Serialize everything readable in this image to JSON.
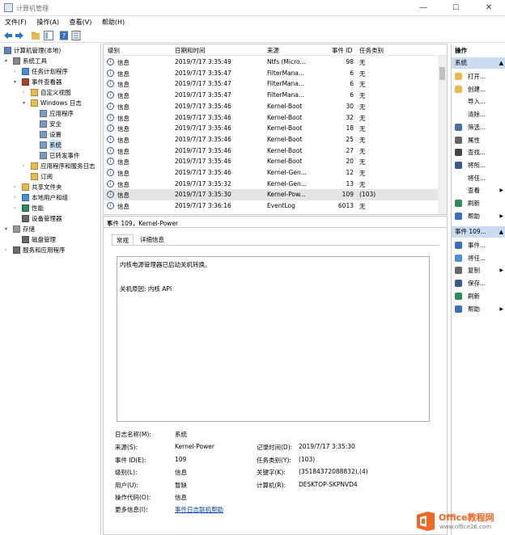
{
  "window": {
    "title": "计算机管理",
    "minimize": "—",
    "maximize": "☐",
    "close": "✕"
  },
  "menu": [
    "文件(F)",
    "操作(A)",
    "查看(V)",
    "帮助(H)"
  ],
  "tree": [
    {
      "label": "计算机管理(本地)",
      "level": 0,
      "exp": "",
      "icon": "computer-icon"
    },
    {
      "label": "系统工具",
      "level": 1,
      "exp": "▾",
      "icon": "tools-icon"
    },
    {
      "label": "任务计划程序",
      "level": 2,
      "exp": "›",
      "icon": "clock-icon"
    },
    {
      "label": "事件查看器",
      "level": 2,
      "exp": "▾",
      "icon": "event-viewer-icon"
    },
    {
      "label": "自定义视图",
      "level": 3,
      "exp": "›",
      "icon": "folder-icon"
    },
    {
      "label": "Windows 日志",
      "level": 3,
      "exp": "▾",
      "icon": "folder-icon"
    },
    {
      "label": "应用程序",
      "level": 4,
      "exp": "",
      "icon": "log-icon"
    },
    {
      "label": "安全",
      "level": 4,
      "exp": "",
      "icon": "log-icon"
    },
    {
      "label": "设置",
      "level": 4,
      "exp": "",
      "icon": "log-icon"
    },
    {
      "label": "系统",
      "level": 4,
      "exp": "",
      "icon": "log-icon",
      "selected": true
    },
    {
      "label": "已转发事件",
      "level": 4,
      "exp": "",
      "icon": "log-icon"
    },
    {
      "label": "应用程序和服务日志",
      "level": 3,
      "exp": "›",
      "icon": "folder-icon"
    },
    {
      "label": "订阅",
      "level": 3,
      "exp": "",
      "icon": "subscription-icon"
    },
    {
      "label": "共享文件夹",
      "level": 2,
      "exp": "›",
      "icon": "shared-folder-icon"
    },
    {
      "label": "本地用户和组",
      "level": 2,
      "exp": "›",
      "icon": "users-icon"
    },
    {
      "label": "性能",
      "level": 2,
      "exp": "›",
      "icon": "performance-icon"
    },
    {
      "label": "设备管理器",
      "level": 2,
      "exp": "",
      "icon": "device-manager-icon"
    },
    {
      "label": "存储",
      "level": 1,
      "exp": "▾",
      "icon": "storage-icon"
    },
    {
      "label": "磁盘管理",
      "level": 2,
      "exp": "",
      "icon": "disk-icon"
    },
    {
      "label": "服务和应用程序",
      "level": 1,
      "exp": "›",
      "icon": "services-icon"
    }
  ],
  "events": {
    "headers": [
      "级别",
      "日期和时间",
      "来源",
      "事件 ID",
      "任务类别"
    ],
    "rows": [
      [
        "信息",
        "2019/7/17 3:35:49",
        "Ntfs (Micro...",
        "98",
        "无"
      ],
      [
        "信息",
        "2019/7/17 3:35:47",
        "FilterMana...",
        "6",
        "无"
      ],
      [
        "信息",
        "2019/7/17 3:35:47",
        "FilterMana...",
        "6",
        "无"
      ],
      [
        "信息",
        "2019/7/17 3:35:47",
        "FilterMana...",
        "6",
        "无"
      ],
      [
        "信息",
        "2019/7/17 3:35:46",
        "Kernel-Boot",
        "30",
        "无"
      ],
      [
        "信息",
        "2019/7/17 3:35:46",
        "Kernel-Boot",
        "32",
        "无"
      ],
      [
        "信息",
        "2019/7/17 3:35:46",
        "Kernel-Boot",
        "18",
        "无"
      ],
      [
        "信息",
        "2019/7/17 3:35:46",
        "Kernel-Boot",
        "25",
        "无"
      ],
      [
        "信息",
        "2019/7/17 3:35:46",
        "Kernel-Boot",
        "27",
        "无"
      ],
      [
        "信息",
        "2019/7/17 3:35:46",
        "Kernel-Boot",
        "20",
        "无"
      ],
      [
        "信息",
        "2019/7/17 3:35:46",
        "Kernel-Gen...",
        "12",
        "无"
      ],
      [
        "信息",
        "2019/7/17 3:35:32",
        "Kernel-Gen...",
        "13",
        "无"
      ],
      [
        "信息",
        "2019/7/17 3:35:30",
        "Kernel-Pow...",
        "109",
        "(103)"
      ],
      [
        "信息",
        "2019/7/17 3:36:16",
        "EventLog",
        "6013",
        "无"
      ]
    ],
    "highlighted_row": 12
  },
  "detail": {
    "title": "事件 109，Kernel-Power",
    "close": "✕",
    "tabs": [
      "常规",
      "详细信息"
    ],
    "description_line1": "内核电源管理器已启动关机转换。",
    "description_line2": "关机原因: 内核 API",
    "fields": {
      "log_name_label": "日志名称(M):",
      "log_name": "系统",
      "source_label": "来源(S):",
      "source": "Kernel-Power",
      "logged_label": "记录时间(D):",
      "logged": "2019/7/17 3:35:30",
      "event_id_label": "事件 ID(E):",
      "event_id": "109",
      "task_label": "任务类别(Y):",
      "task": "(103)",
      "level_label": "级别(L):",
      "level": "信息",
      "keywords_label": "关键字(K):",
      "keywords": "(35184372088832),(4)",
      "user_label": "用户(U):",
      "user": "暂缺",
      "computer_label": "计算机(R):",
      "computer": "DESKTOP-SKPNVD4",
      "opcode_label": "操作代码(O):",
      "opcode": "信息",
      "more_label": "更多信息(I):",
      "more_link": "事件日志联机帮助"
    }
  },
  "actions": {
    "header": "操作",
    "section1": "系统",
    "items1": [
      {
        "label": "打开...",
        "icon": "open-icon",
        "sub": false
      },
      {
        "label": "创建...",
        "icon": "create-view-icon",
        "sub": false
      },
      {
        "label": "导入...",
        "icon": "",
        "sub": false
      },
      {
        "label": "清除...",
        "icon": "",
        "sub": false
      },
      {
        "label": "筛选...",
        "icon": "filter-icon",
        "sub": false
      },
      {
        "label": "属性",
        "icon": "properties-icon",
        "sub": false
      },
      {
        "label": "查找...",
        "icon": "find-icon",
        "sub": false
      },
      {
        "label": "将所...",
        "icon": "save-icon",
        "sub": false
      },
      {
        "label": "将任...",
        "icon": "",
        "sub": false
      },
      {
        "label": "查看",
        "icon": "",
        "sub": true
      },
      {
        "label": "刷新",
        "icon": "refresh-icon",
        "sub": false
      },
      {
        "label": "帮助",
        "icon": "help-icon",
        "sub": true
      }
    ],
    "section2": "事件 109...",
    "items2": [
      {
        "label": "事件...",
        "icon": "event-properties-icon",
        "sub": false
      },
      {
        "label": "将任...",
        "icon": "attach-task-icon",
        "sub": false
      },
      {
        "label": "复制",
        "icon": "copy-icon",
        "sub": true
      },
      {
        "label": "保存...",
        "icon": "save-icon",
        "sub": false
      },
      {
        "label": "刷新",
        "icon": "refresh-icon",
        "sub": false
      },
      {
        "label": "帮助",
        "icon": "help-icon",
        "sub": true
      }
    ]
  },
  "watermark": {
    "brand": "Office教程网",
    "url": "www.office26.com"
  },
  "colors": {
    "selection": "#cde8ff",
    "section": "#c9dcf1",
    "link": "#0645ad",
    "logo_orange": "#f26522"
  }
}
